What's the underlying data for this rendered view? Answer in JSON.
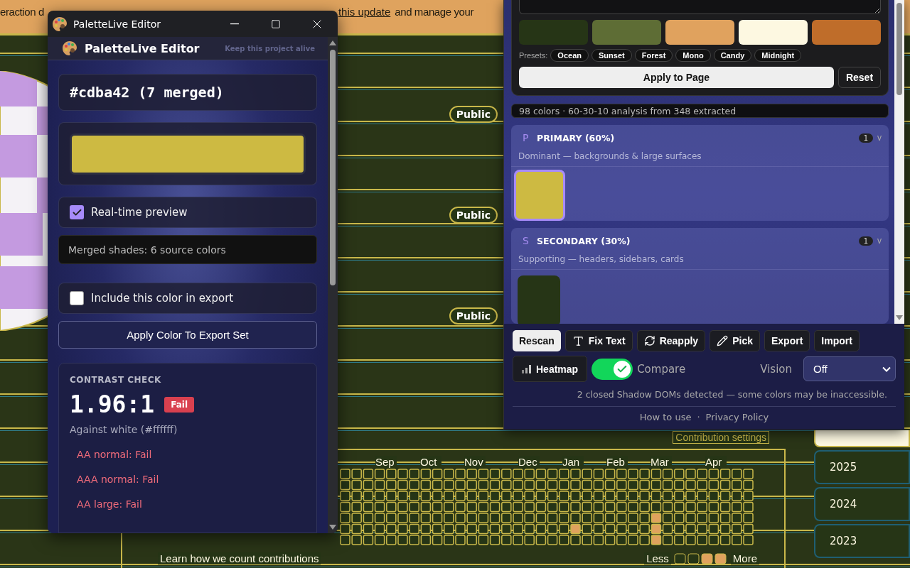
{
  "background_page": {
    "banner": {
      "left_text": "eraction d",
      "link": "this update",
      "right_text": "and manage your"
    },
    "repo_badges": [
      "Public",
      "Public",
      "Public"
    ],
    "contribution_settings": "Contribution settings",
    "calendar": {
      "months": [
        "Sep",
        "Oct",
        "Nov",
        "Dec",
        "Jan",
        "Feb",
        "Mar",
        "Apr"
      ],
      "footer_link": "Learn how we count contributions",
      "less": "Less",
      "more": "More"
    },
    "years": [
      "2025",
      "2024",
      "2023"
    ]
  },
  "editor_window": {
    "title": "PaletteLive Editor",
    "header_title": "PaletteLive Editor",
    "header_link": "Keep this project alive",
    "color_label": "#cdba42 (7 merged)",
    "color": "#cdba42",
    "realtime_preview": {
      "label": "Real-time preview",
      "checked": true
    },
    "merged_info": "Merged shades: 6 source colors",
    "include_in_export": {
      "label": "Include this color in export",
      "checked": false
    },
    "apply_button": "Apply Color To Export Set",
    "contrast": {
      "heading": "CONTRAST CHECK",
      "ratio": "1.96:1",
      "verdict": "Fail",
      "against": "Against white (#ffffff)",
      "results": [
        "AA normal: Fail",
        "AAA normal: Fail",
        "AA large: Fail"
      ]
    }
  },
  "palette_panel": {
    "swatches": [
      {
        "color": "#263516"
      },
      {
        "color": "#5e6d35"
      },
      {
        "color": "#e0a25e"
      },
      {
        "color": "#fdf8e1"
      },
      {
        "color": "#bf6d2a"
      }
    ],
    "presets_label": "Presets:",
    "presets": [
      "Ocean",
      "Sunset",
      "Forest",
      "Mono",
      "Candy",
      "Midnight"
    ],
    "apply_button": "Apply to Page",
    "reset_button": "Reset",
    "summary": "98 colors · 60-30-10 analysis from 348 extracted",
    "groups": [
      {
        "letter": "P",
        "title": "PRIMARY (60%)",
        "count": "1",
        "toggle": "v",
        "description": "Dominant — backgrounds & large surfaces",
        "colors": [
          {
            "color": "#cdba42",
            "selected": true
          }
        ]
      },
      {
        "letter": "S",
        "title": "SECONDARY (30%)",
        "count": "1",
        "toggle": "v",
        "description": "Supporting — headers, sidebars, cards",
        "colors": [
          {
            "color": "#263516",
            "selected": false
          }
        ]
      }
    ],
    "toolbar": [
      {
        "label": "Rescan",
        "kind": "primary"
      },
      {
        "label": "Fix Text",
        "kind": "text"
      },
      {
        "label": "Reapply",
        "kind": "refresh"
      },
      {
        "label": "Pick",
        "kind": "pick"
      },
      {
        "label": "Export",
        "kind": "plain"
      },
      {
        "label": "Import",
        "kind": "plain"
      }
    ],
    "heatmap_button": "Heatmap",
    "compare": {
      "label": "Compare",
      "on": true
    },
    "vision": {
      "label": "Vision",
      "value": "Off"
    },
    "notice": "2 closed Shadow DOMs detected — some colors may be inaccessible.",
    "footer": {
      "links": [
        "How to use",
        "Privacy Policy"
      ],
      "separator": "·"
    }
  }
}
